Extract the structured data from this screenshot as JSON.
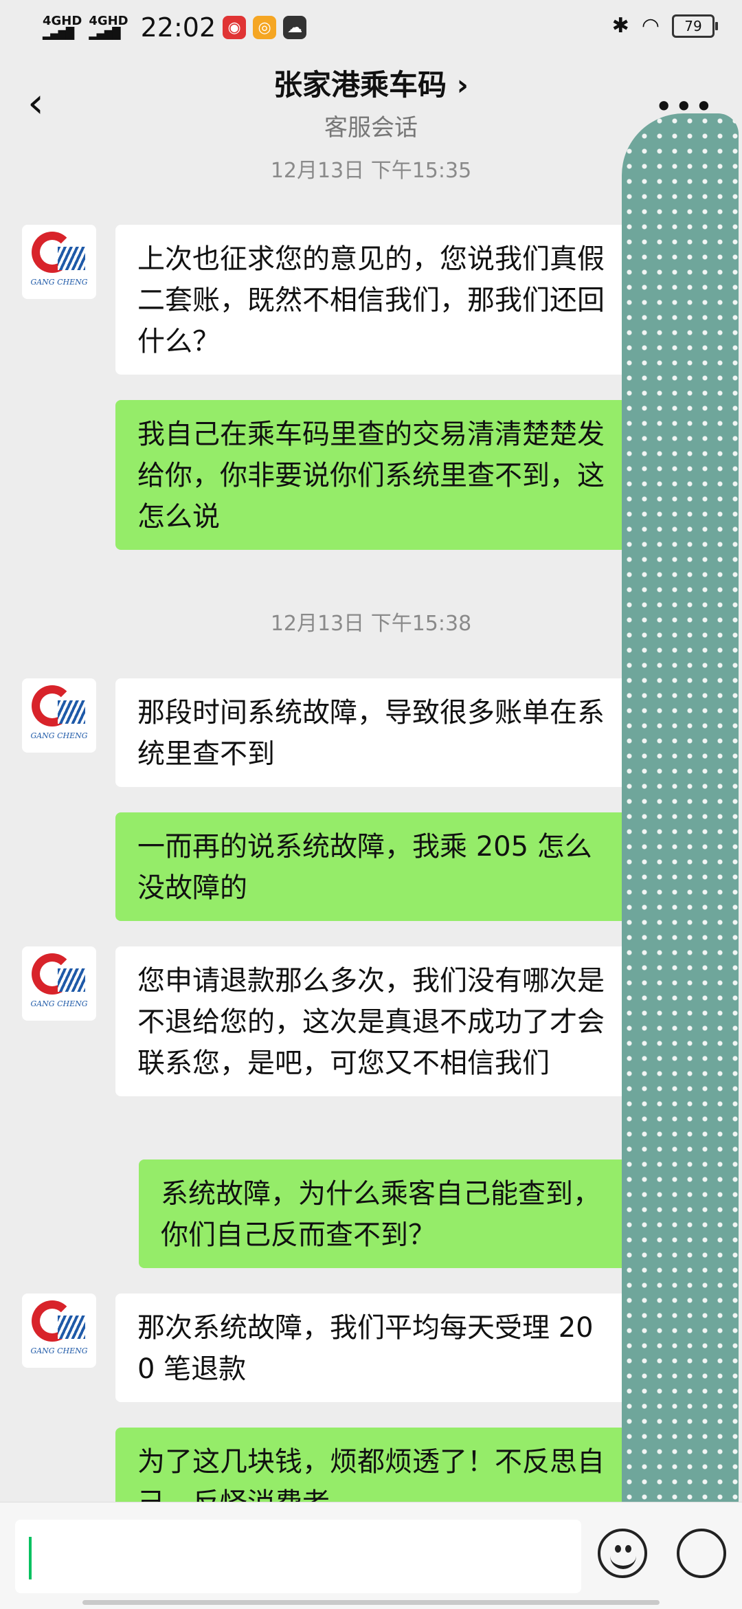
{
  "status_bar": {
    "signal1": "4GHD",
    "signal2": "4GHD",
    "time": "22:02",
    "battery": "79",
    "icons": [
      "weibo-app-icon",
      "uc-app-icon",
      "cloud-icon",
      "bluetooth-icon",
      "wifi-icon"
    ]
  },
  "header": {
    "title": "张家港乘车码",
    "chevron": "›",
    "subtitle": "客服会话",
    "more": "•••"
  },
  "avatar": {
    "brand_text": "GANG CHENG"
  },
  "messages": [
    {
      "type": "timestamp",
      "text": "12月13日  下午15:35"
    },
    {
      "type": "in",
      "text": "上次也征求您的意见的，您说我们真假二套账，既然不相信我们，那我们还回什么？"
    },
    {
      "type": "out",
      "text": "我自己在乘车码里查的交易清清楚楚发给你，你非要说你们系统里查不到，这怎么说"
    },
    {
      "type": "timestamp",
      "text": "12月13日  下午15:38"
    },
    {
      "type": "in",
      "text": "那段时间系统故障，导致很多账单在系统里查不到"
    },
    {
      "type": "out",
      "text": "一而再的说系统故障，我乘 205 怎么没故障的"
    },
    {
      "type": "in",
      "text": "您申请退款那么多次，我们没有哪次是不退给您的，这次是真退不成功了才会联系您，是吧，可您又不相信我们"
    },
    {
      "type": "out",
      "text": "系统故障，为什么乘客自己能查到，你们自己反而查不到？"
    },
    {
      "type": "in",
      "text": "那次系统故障，我们平均每天受理 200 笔退款"
    },
    {
      "type": "out",
      "text": "为了这几块钱，烦都烦透了！不反思自己，反怪消费者"
    }
  ],
  "input": {
    "value": "",
    "placeholder": ""
  },
  "colors": {
    "incoming_bubble": "#ffffff",
    "outgoing_bubble": "#95ec69",
    "background": "#ededed",
    "cursor": "#07c160"
  }
}
